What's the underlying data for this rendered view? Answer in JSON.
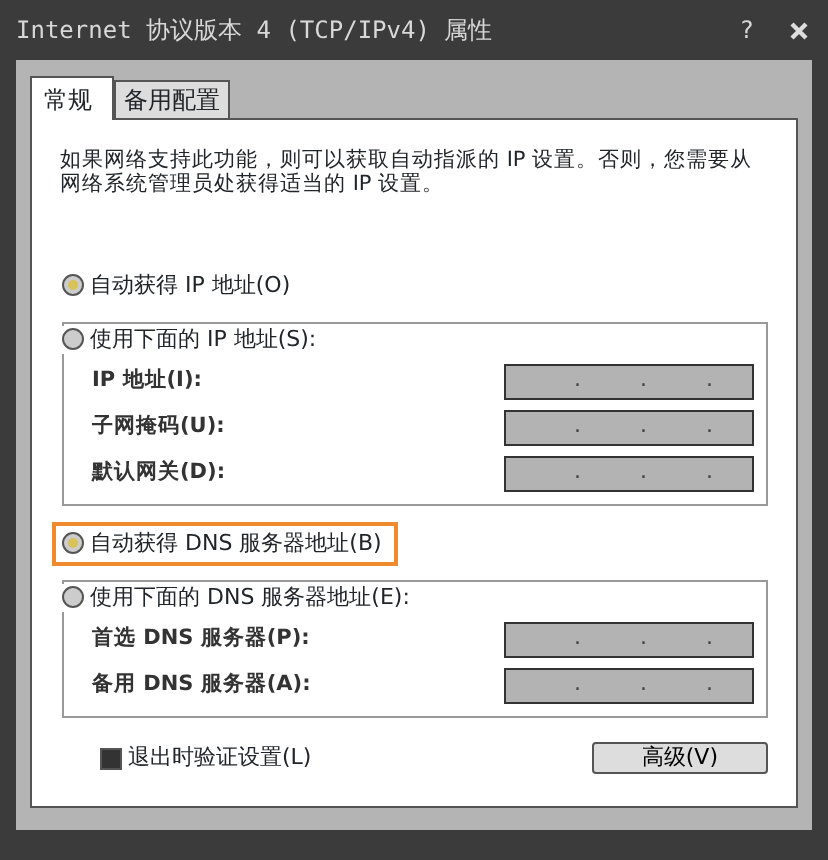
{
  "window": {
    "title": "Internet 协议版本 4 (TCP/IPv4) 属性",
    "help": "?"
  },
  "tabs": [
    {
      "label": "常规",
      "selected": true
    },
    {
      "label": "备用配置",
      "selected": false
    }
  ],
  "description": "如果网络支持此功能，则可以获取自动指派的 IP 设置。否则，您需要从网络系统管理员处获得适当的 IP 设置。",
  "ip": {
    "auto": {
      "label": "自动获得 IP 地址(O)",
      "selected": true,
      "highlighted": false
    },
    "manual": {
      "label": "使用下面的 IP 地址(S):",
      "selected": false,
      "highlighted": false
    },
    "fields": [
      {
        "label": "IP 地址(I):",
        "value": ". . ."
      },
      {
        "label": "子网掩码(U):",
        "value": ". . ."
      },
      {
        "label": "默认网关(D):",
        "value": ". . ."
      }
    ]
  },
  "dns": {
    "auto": {
      "label": "自动获得 DNS 服务器地址(B)",
      "selected": true,
      "highlighted": true
    },
    "manual": {
      "label": "使用下面的 DNS 服务器地址(E):",
      "selected": false,
      "highlighted": false
    },
    "fields": [
      {
        "label": "首选 DNS 服务器(P):",
        "value": ". . ."
      },
      {
        "label": "备用 DNS 服务器(A):",
        "value": ". . ."
      }
    ]
  },
  "validate": {
    "label": "退出时验证设置(L)",
    "checked": true
  },
  "advanced_button": "高级(V)"
}
